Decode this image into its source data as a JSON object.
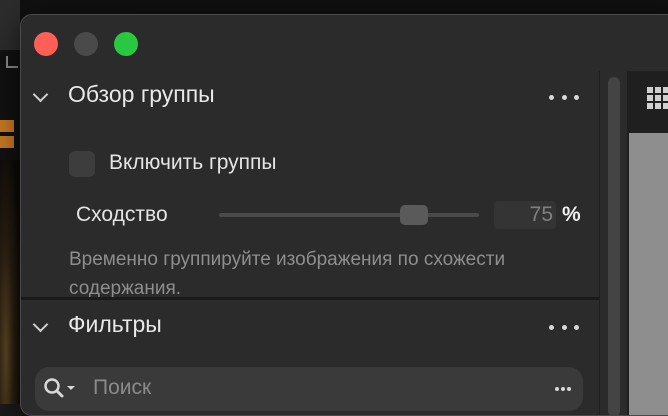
{
  "window": {
    "controls": [
      "close",
      "minimize",
      "zoom"
    ]
  },
  "group_overview": {
    "title": "Обзор группы",
    "enable_label": "Включить группы",
    "enabled": false,
    "similarity": {
      "label": "Сходство",
      "value": "75",
      "unit": "%",
      "level_percent": 75
    },
    "description": "Временно группируйте изображения по схожести содержания."
  },
  "filters": {
    "title": "Фильтры",
    "search": {
      "placeholder": "Поиск",
      "value": ""
    }
  },
  "icons": {
    "section_menu": "ellipsis-icon",
    "collapse": "chevron-down-icon",
    "search": "search-icon",
    "grid_view": "grid-icon"
  },
  "colors": {
    "close": "#ff5f57",
    "minimize": "#4a4a4a",
    "zoom": "#28c840"
  }
}
